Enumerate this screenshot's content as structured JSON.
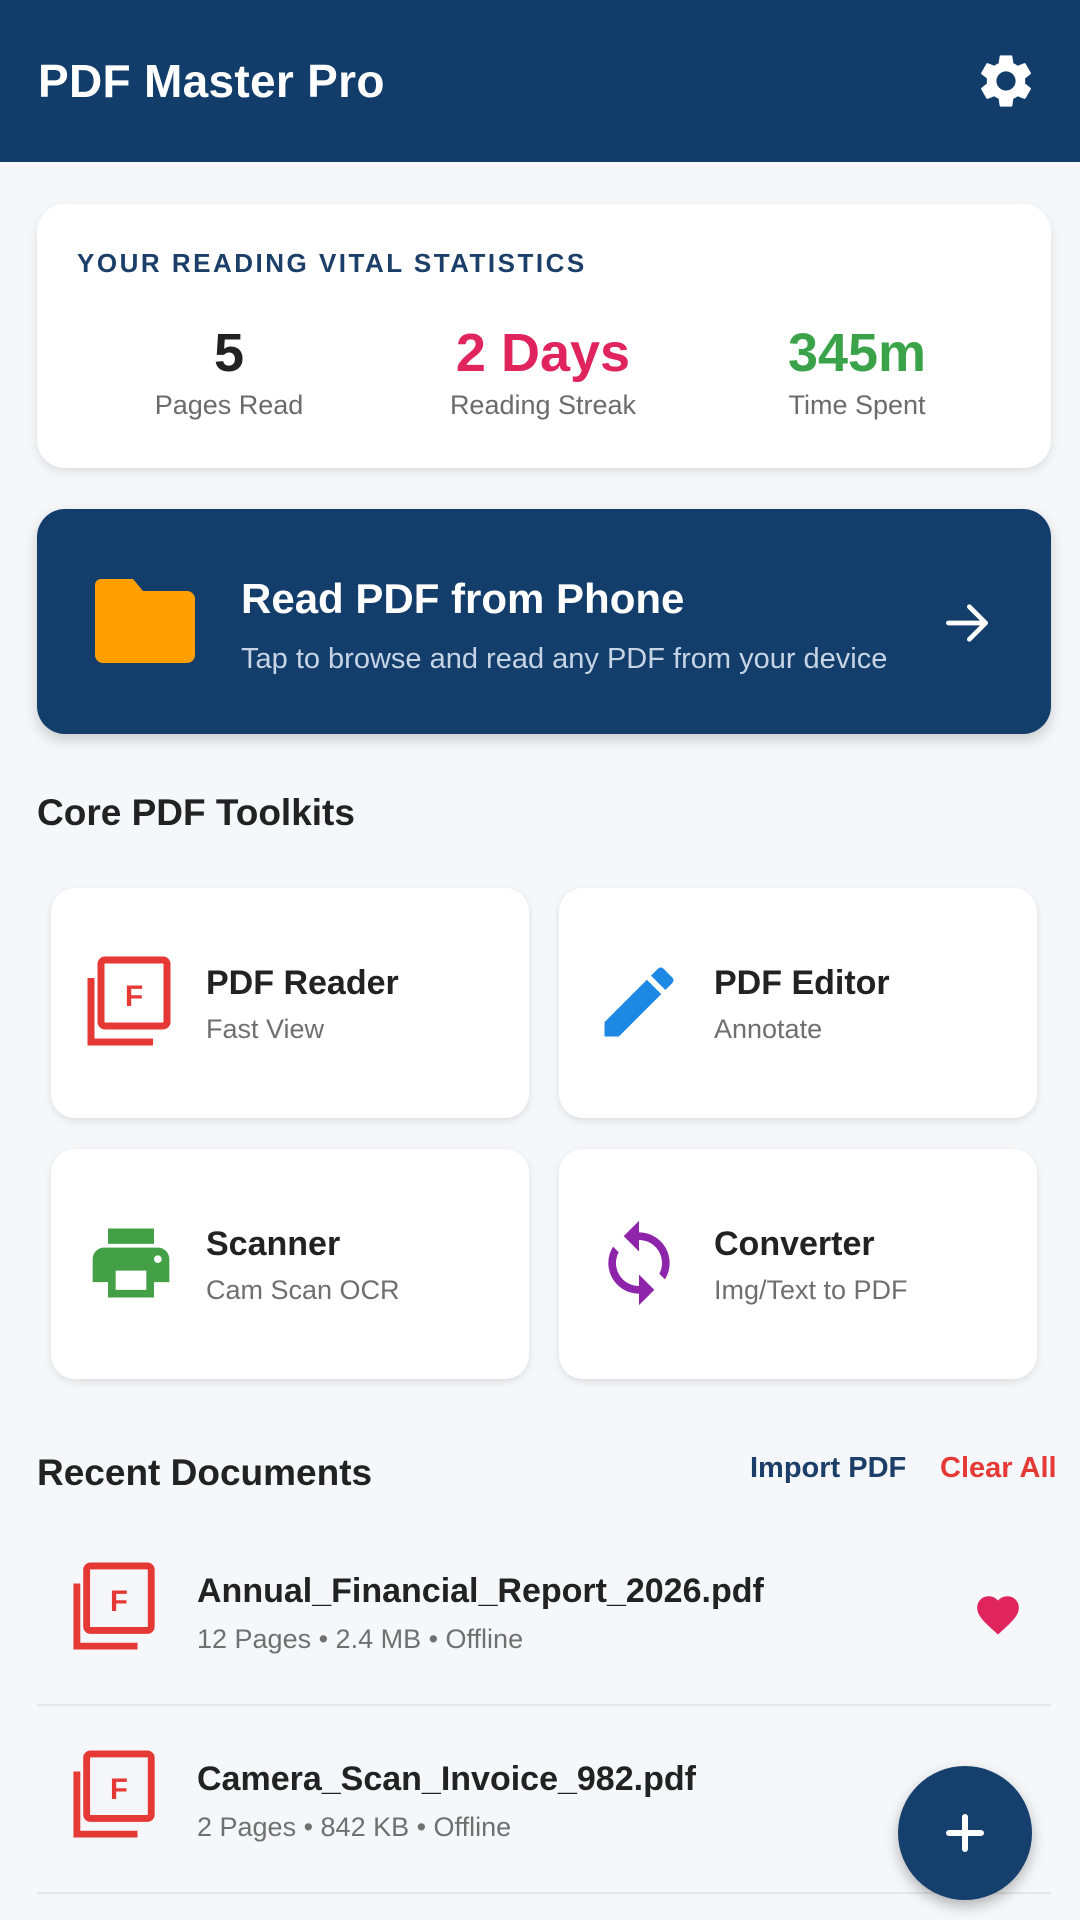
{
  "app": {
    "title": "PDF Master Pro",
    "brand_color": "#123d6b"
  },
  "stats": {
    "heading": "YOUR READING VITAL STATISTICS",
    "items": [
      {
        "value": "5",
        "label": "Pages Read",
        "color": "#222222"
      },
      {
        "value": "2 Days",
        "label": "Reading Streak",
        "color": "#e0245e"
      },
      {
        "value": "345m",
        "label": "Time Spent",
        "color": "#3aa34a"
      }
    ]
  },
  "hero": {
    "title": "Read PDF from Phone",
    "subtitle": "Tap to browse and read any PDF from your device",
    "icon": "folder-icon",
    "action_icon": "arrow-right-icon"
  },
  "toolkits": {
    "title": "Core PDF Toolkits",
    "items": [
      {
        "name": "PDF Reader",
        "sub": "Fast View",
        "icon": "pdf-file-icon",
        "color": "#e53935"
      },
      {
        "name": "PDF Editor",
        "sub": "Annotate",
        "icon": "pencil-icon",
        "color": "#1e88e5"
      },
      {
        "name": "Scanner",
        "sub": "Cam Scan OCR",
        "icon": "printer-icon",
        "color": "#43a047"
      },
      {
        "name": "Converter",
        "sub": "Img/Text to PDF",
        "icon": "sync-icon",
        "color": "#8e24aa"
      }
    ]
  },
  "recent": {
    "title": "Recent Documents",
    "import_label": "Import PDF",
    "clear_label": "Clear All",
    "documents": [
      {
        "name": "Annual_Financial_Report_2026.pdf",
        "meta": "12 Pages • 2.4 MB • Offline",
        "favorite": true
      },
      {
        "name": "Camera_Scan_Invoice_982.pdf",
        "meta": "2 Pages • 842 KB • Offline",
        "favorite": false
      }
    ]
  },
  "fab": {
    "icon": "plus-icon"
  }
}
